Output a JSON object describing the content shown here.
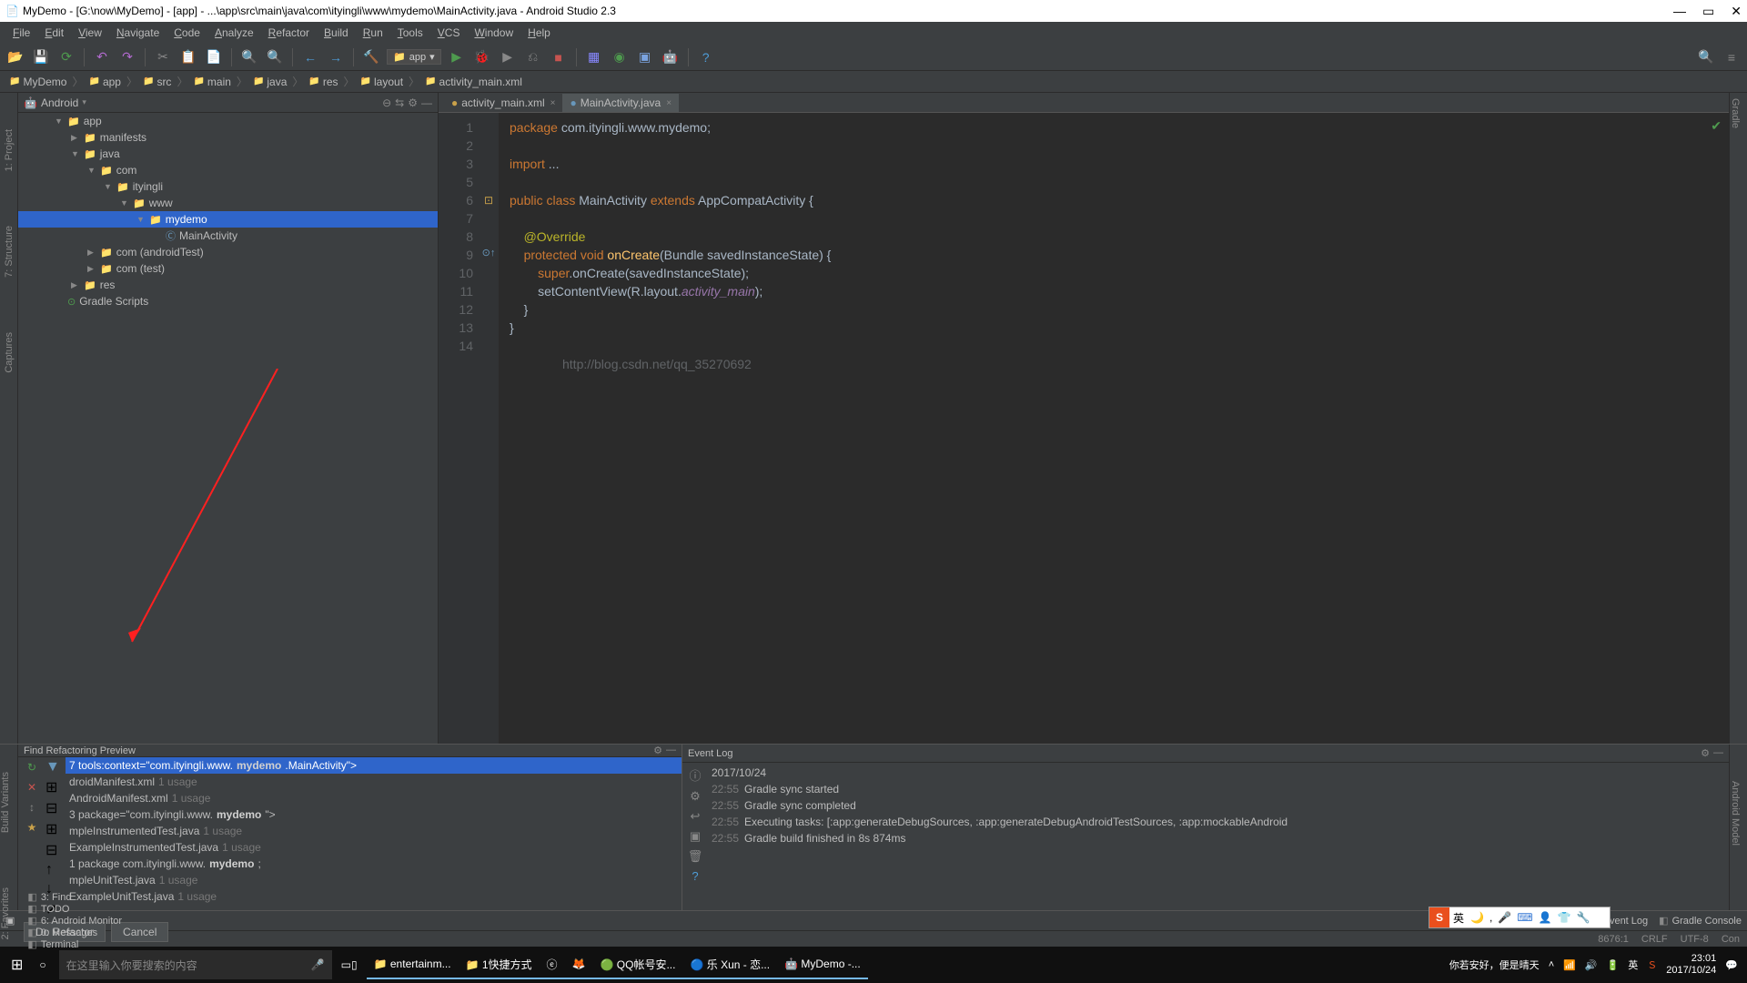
{
  "title": "MyDemo - [G:\\now\\MyDemo] - [app] - ...\\app\\src\\main\\java\\com\\ityingli\\www\\mydemo\\MainActivity.java - Android Studio 2.3",
  "menu": [
    "File",
    "Edit",
    "View",
    "Navigate",
    "Code",
    "Analyze",
    "Refactor",
    "Build",
    "Run",
    "Tools",
    "VCS",
    "Window",
    "Help"
  ],
  "run_sel": "app",
  "breadcrumb": [
    "MyDemo",
    "app",
    "src",
    "main",
    "java",
    "res",
    "layout",
    "activity_main.xml"
  ],
  "proj_header": "Android",
  "tree": [
    {
      "ind": 0,
      "arr": "▼",
      "ico": "📁",
      "lbl": "app",
      "cls": ""
    },
    {
      "ind": 1,
      "arr": "▶",
      "ico": "📁",
      "lbl": "manifests",
      "cls": ""
    },
    {
      "ind": 1,
      "arr": "▼",
      "ico": "📁",
      "lbl": "java",
      "cls": ""
    },
    {
      "ind": 2,
      "arr": "▼",
      "ico": "📁",
      "lbl": "com",
      "cls": ""
    },
    {
      "ind": 3,
      "arr": "▼",
      "ico": "📁",
      "lbl": "ityingli",
      "cls": ""
    },
    {
      "ind": 4,
      "arr": "▼",
      "ico": "📁",
      "lbl": "www",
      "cls": ""
    },
    {
      "ind": 5,
      "arr": "▼",
      "ico": "📁",
      "lbl": "mydemo",
      "cls": "selected"
    },
    {
      "ind": 6,
      "arr": "",
      "ico": "Ⓒ",
      "lbl": "MainActivity",
      "cls": ""
    },
    {
      "ind": 2,
      "arr": "▶",
      "ico": "📁",
      "lbl": "com (androidTest)",
      "cls": ""
    },
    {
      "ind": 2,
      "arr": "▶",
      "ico": "📁",
      "lbl": "com (test)",
      "cls": ""
    },
    {
      "ind": 1,
      "arr": "▶",
      "ico": "📁",
      "lbl": "res",
      "cls": ""
    },
    {
      "ind": 0,
      "arr": "",
      "ico": "⊙",
      "lbl": "Gradle Scripts",
      "cls": ""
    }
  ],
  "tabs": [
    {
      "lbl": "activity_main.xml",
      "active": false
    },
    {
      "lbl": "MainActivity.java",
      "active": true
    }
  ],
  "code_lines": [
    "1",
    "2",
    "3",
    "5",
    "6",
    "7",
    "8",
    "9",
    "10",
    "11",
    "12",
    "13",
    "14"
  ],
  "code": {
    "l1_pkg": "package",
    "l1_rest": " com.ityingli.www.mydemo;",
    "l3_import": "import",
    "l3_rest": " ...",
    "l6_public": "public class",
    "l6_name": " MainActivity ",
    "l6_ext": "extends",
    "l6_ac": " AppCompatActivity {",
    "l8_ann": "@Override",
    "l9_prot": "protected void",
    "l9_fn": " onCreate",
    "l9_args": "(Bundle savedInstanceState) {",
    "l10_super": "super",
    "l10_rest": ".onCreate(savedInstanceState);",
    "l11_a": "setContentView(R.layout.",
    "l11_it": "activity_main",
    "l11_b": ");",
    "l12": "}",
    "l13": "}"
  },
  "watermark": "http://blog.csdn.net/qq_35270692",
  "find_header": "Find Refactoring Preview",
  "find_rows": [
    {
      "sel": true,
      "txt": "7 tools:context=\"com.ityingli.www.",
      "b": "mydemo",
      "txt2": ".MainActivity\">"
    },
    {
      "sel": false,
      "txt": "droidManifest.xml ",
      "u": "1 usage"
    },
    {
      "sel": false,
      "txt": "AndroidManifest.xml ",
      "u": "1 usage"
    },
    {
      "sel": false,
      "txt": "    3 package=\"com.ityingli.www.",
      "b": "mydemo",
      "txt2": "\">"
    },
    {
      "sel": false,
      "txt": "mpleInstrumentedTest.java ",
      "u": "1 usage"
    },
    {
      "sel": false,
      "txt": "ExampleInstrumentedTest.java ",
      "u": "1 usage"
    },
    {
      "sel": false,
      "txt": "    1 package com.ityingli.www.",
      "b": "mydemo",
      "txt2": ";"
    },
    {
      "sel": false,
      "txt": "mpleUnitTest.java ",
      "u": "1 usage"
    },
    {
      "sel": false,
      "txt": "ExampleUnitTest.java ",
      "u": "1 usage"
    }
  ],
  "btn_do": "Do Refactor",
  "btn_cancel": "Cancel",
  "event_header": "Event Log",
  "events": [
    {
      "d": "2017/10/24",
      "t": "",
      "m": ""
    },
    {
      "d": "",
      "t": "22:55",
      "m": "Gradle sync started"
    },
    {
      "d": "",
      "t": "22:55",
      "m": "Gradle sync completed"
    },
    {
      "d": "",
      "t": "22:55",
      "m": "Executing tasks: [:app:generateDebugSources, :app:generateDebugAndroidTestSources, :app:mockableAndroid"
    },
    {
      "d": "",
      "t": "22:55",
      "m": "Gradle build finished in 8s 874ms"
    }
  ],
  "docks_l": [
    "3: Find",
    "TODO",
    "6: Android Monitor",
    "0: Messages",
    "Terminal"
  ],
  "docks_r": [
    "Event Log",
    "Gradle Console"
  ],
  "status": {
    "pos": "8676:1",
    "crlf": "CRLF",
    "enc": "UTF-8",
    "ctx": "Con"
  },
  "left_tabs": [
    "1: Project",
    "7: Structure",
    "Captures"
  ],
  "left_tabs2": [
    "Build Variants",
    "2: Favorites"
  ],
  "right_tab_top": "Gradle",
  "right_tab_bot": "Android Model",
  "tb_search_ph": "在这里输入你要搜索的内容",
  "tb_items": [
    "entertainm...",
    "1快捷方式",
    "",
    "",
    "QQ帐号安...",
    "乐 Xun - 恋...",
    "MyDemo -..."
  ],
  "tb_weather": "你若安好，便是晴天",
  "tb_clock_t": "23:01",
  "tb_clock_d": "2017/10/24",
  "sime_label": "英"
}
